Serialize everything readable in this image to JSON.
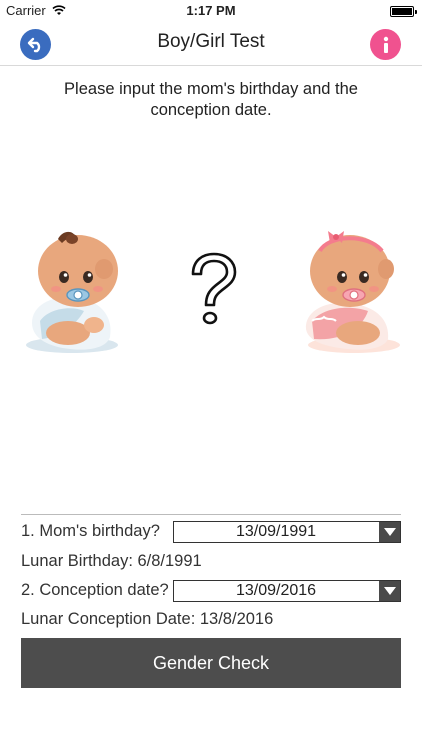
{
  "status_bar": {
    "carrier": "Carrier",
    "time": "1:17 PM"
  },
  "nav": {
    "title": "Boy/Girl Test",
    "back_icon": "back-arrow-icon",
    "info_icon": "info-icon"
  },
  "instructions": "Please input the mom's birthday and the conception date.",
  "form": {
    "birthday_label": "1. Mom's birthday?",
    "birthday_value": "13/09/1991",
    "lunar_birthday": "Lunar Birthday: 6/8/1991",
    "conception_label": "2. Conception date?",
    "conception_value": "13/09/2016",
    "lunar_conception": "Lunar Conception Date: 13/8/2016"
  },
  "actions": {
    "gender_check_label": "Gender Check"
  },
  "colors": {
    "back_button": "#3a6cbf",
    "info_button": "#f0528f",
    "primary_button": "#4d4d4d"
  }
}
